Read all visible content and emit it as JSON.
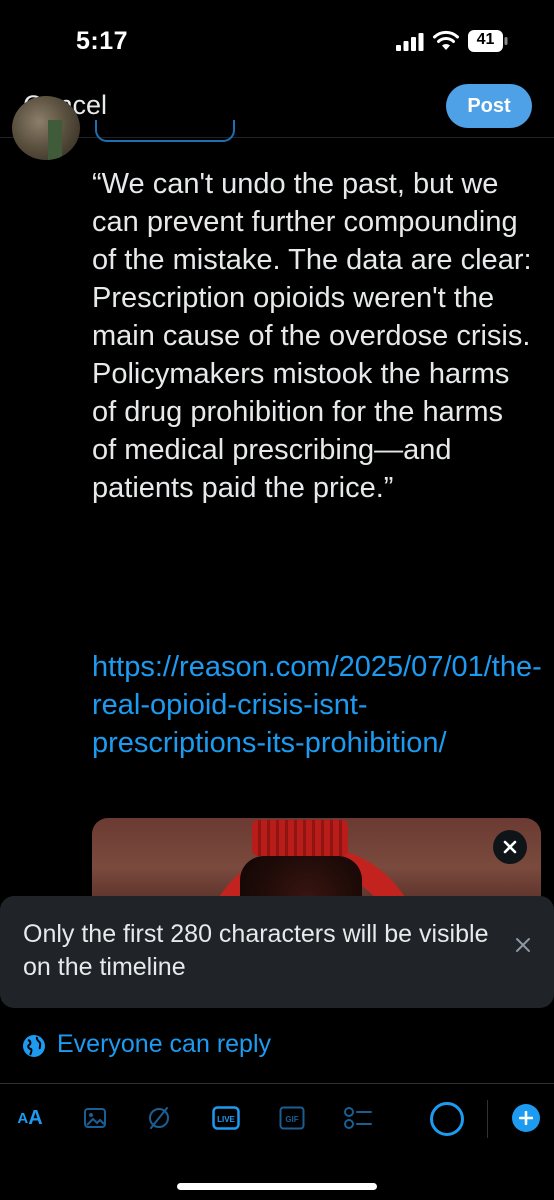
{
  "status_bar": {
    "time": "5:17",
    "battery_level": "41",
    "icons": [
      "signal-icon",
      "wifi-icon",
      "battery-icon"
    ]
  },
  "header": {
    "cancel_label": "Cancel",
    "post_label": "Post"
  },
  "compose": {
    "text": "“We can't undo the past, but we can prevent further compounding of the mistake. The data are clear: Prescription opioids weren't the main cause of the overdose crisis. Policymakers mistook the harms of drug prohibition for the harms of medical prescribing—and patients paid the price.”",
    "link": "https://reason.com/2025/07/01/the-real-opioid-crisis-isnt-prescriptions-its-prohibition/"
  },
  "toast": {
    "message": "Only the first 280 characters will be visible on the timeline"
  },
  "reply_setting": {
    "label": "Everyone can reply"
  },
  "toolbar": {
    "text_format_small": "A",
    "text_format_big": "A",
    "icons": [
      "text-format-icon",
      "image-icon",
      "slash-icon",
      "live-icon",
      "gif-icon",
      "poll-icon",
      "character-counter-icon",
      "add-post-icon"
    ]
  },
  "colors": {
    "accent": "#1d9bf0",
    "post_button": "#4ea1e6",
    "background": "#000000",
    "toast_bg": "#202327"
  }
}
